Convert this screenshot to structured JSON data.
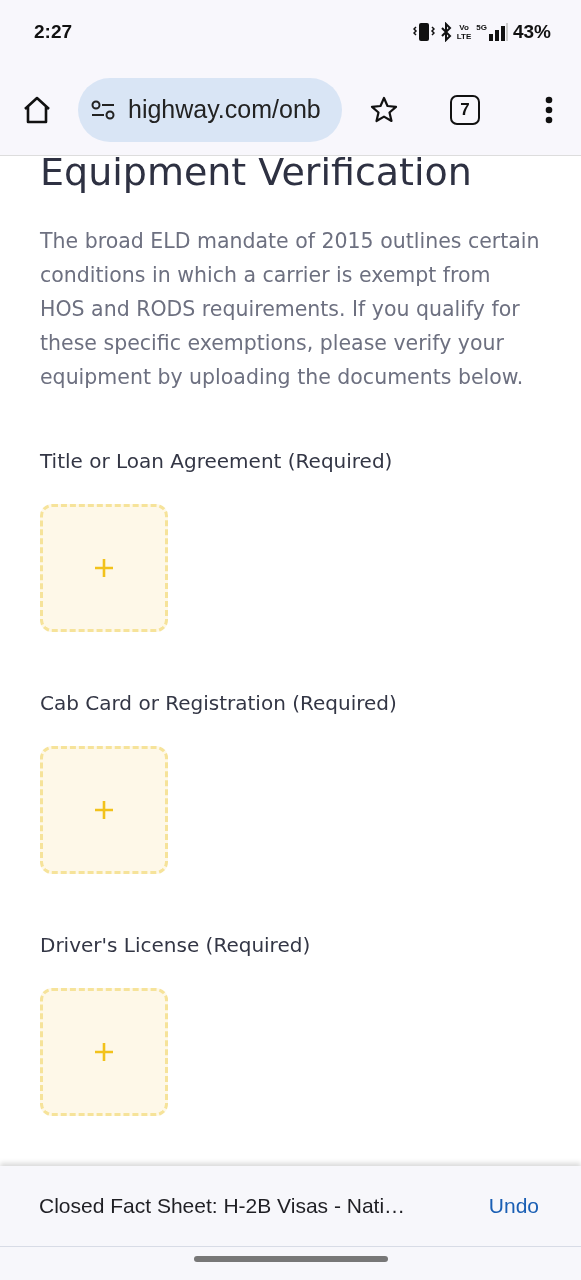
{
  "status_bar": {
    "time": "2:27",
    "volte": [
      "Vo",
      "LTE"
    ],
    "network": "5G",
    "battery": "43%"
  },
  "toolbar": {
    "url": "highway.com/onb",
    "tab_count": "7"
  },
  "page": {
    "title": "Equipment Verification",
    "intro": "The broad ELD mandate of 2015 outlines certain conditions in which a carrier is exempt from HOS and RODS requirements. If you qualify for these specific exemptions, please verify your equipment by uploading the documents below.",
    "uploads": [
      {
        "label": "Title or Loan Agreement (Required)"
      },
      {
        "label": "Cab Card or Registration (Required)"
      },
      {
        "label": "Driver's License (Required)"
      }
    ]
  },
  "snackbar": {
    "message": "Closed Fact Sheet: H-2B Visas - Nati…",
    "action": "Undo"
  }
}
